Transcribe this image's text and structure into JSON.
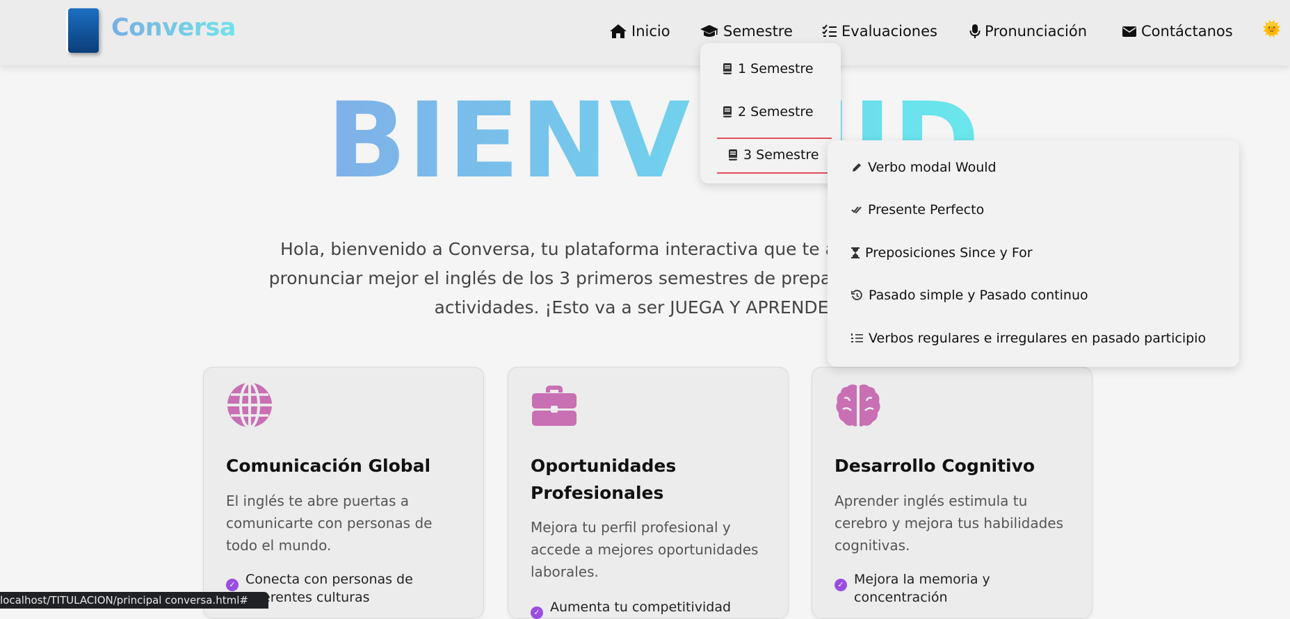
{
  "brand": {
    "name": "Conversa"
  },
  "nav": {
    "items": [
      {
        "label": "Inicio",
        "icon": "home-icon"
      },
      {
        "label": "Semestre",
        "icon": "graduation-cap-icon"
      },
      {
        "label": "Evaluaciones",
        "icon": "list-check-icon"
      },
      {
        "label": "Pronunciación",
        "icon": "microphone-icon"
      },
      {
        "label": "Contáctanos",
        "icon": "envelope-icon"
      }
    ]
  },
  "semestre_menu": {
    "items": [
      "1 Semestre",
      "2 Semestre",
      "3 Semestre"
    ],
    "active": "3 Semestre"
  },
  "submenu_3": {
    "items": [
      {
        "label": "Verbo modal Would",
        "icon": "pencil-icon"
      },
      {
        "label": "Presente Perfecto",
        "icon": "double-check-icon"
      },
      {
        "label": "Preposiciones Since y For",
        "icon": "hourglass-icon"
      },
      {
        "label": "Pasado simple y Pasado continuo",
        "icon": "history-icon"
      },
      {
        "label": "Verbos regulares e irregulares en pasado participio",
        "icon": "numbered-list-icon"
      }
    ]
  },
  "hero": {
    "title": "BIENVENIDO",
    "text": "Hola, bienvenido a Conversa, tu plataforma interactiva que te ayudará a aprender y pronunciar mejor el inglés de los 3 primeros semestres de preparatoria, con diferentes actividades. ¡Esto va a ser JUEGA Y APRENDE! 😊"
  },
  "cards": [
    {
      "icon": "globe-icon",
      "title": "Comunicación Global",
      "desc": "El inglés te abre puertas a comunicarte con personas de todo el mundo.",
      "list": [
        "Conecta con personas de diferentes culturas"
      ]
    },
    {
      "icon": "briefcase-icon",
      "title": "Oportunidades Profesionales",
      "desc": "Mejora tu perfil profesional y accede a mejores oportunidades laborales.",
      "list": [
        "Aumenta tu competitividad"
      ]
    },
    {
      "icon": "brain-icon",
      "title": "Desarrollo Cognitivo",
      "desc": "Aprender inglés estimula tu cerebro y mejora tus habilidades cognitivas.",
      "list": [
        "Mejora la memoria y concentración"
      ]
    }
  ],
  "status": {
    "url": "localhost/TITULACION/principal conversa.html#"
  },
  "colors": {
    "accent": "#c96fb4",
    "check": "#9a4de3",
    "active_underline": "#e24c5a"
  }
}
